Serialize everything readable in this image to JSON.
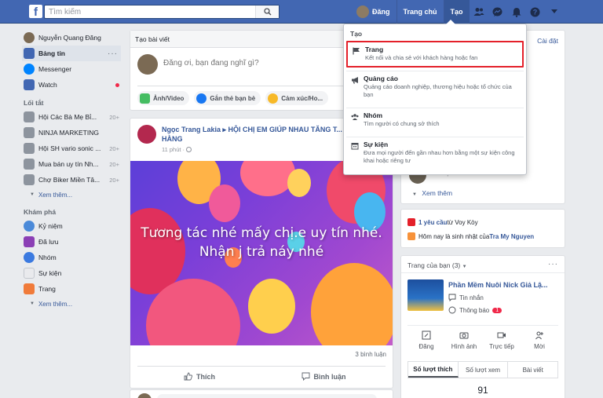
{
  "topbar": {
    "search_placeholder": "Tìm kiếm",
    "user_name": "Đăng",
    "home": "Trang chủ",
    "create": "Tạo"
  },
  "leftnav": {
    "profile_name": "Nguyễn Quang Đăng",
    "items": [
      {
        "label": "Bảng tin"
      },
      {
        "label": "Messenger"
      },
      {
        "label": "Watch"
      }
    ],
    "shortcuts_title": "Lối tắt",
    "shortcuts": [
      {
        "label": "Hội Các Bà Mẹ Bỉ...",
        "count": "20+"
      },
      {
        "label": "NINJA MARKETING",
        "count": ""
      },
      {
        "label": "Hội SH vario sonic ...",
        "count": "20+"
      },
      {
        "label": "Mua bán uy tín Nh...",
        "count": "20+"
      },
      {
        "label": "Chợ Biker Miền Tâ...",
        "count": "20+"
      }
    ],
    "see_more": "Xem thêm...",
    "explore_title": "Khám phá",
    "explore": [
      {
        "label": "Kỷ niệm"
      },
      {
        "label": "Đã lưu"
      },
      {
        "label": "Nhóm"
      },
      {
        "label": "Sự kiện"
      },
      {
        "label": "Trang"
      }
    ],
    "see_more_2": "Xem thêm..."
  },
  "create_post": {
    "title": "Tạo bài viết",
    "placeholder": "Đăng ơi, bạn đang nghĩ gì?",
    "actions": [
      "Ảnh/Video",
      "Gắn thẻ bạn bè",
      "Cảm xúc/Ho..."
    ]
  },
  "post": {
    "author": "Ngọc Trang Lakia ▸ HỘI CHỊ EM GIÚP NHAU TĂNG T... TÁC BÁN HÀNG",
    "time": "11 phút · ",
    "image_text": "Tương tác nhé mấy chị.e uy tín nhé. Nhận j trả náy nhé",
    "comments": "3 bình luận",
    "like": "Thích",
    "comment": "Bình luận"
  },
  "right": {
    "settings": "Cài đặt",
    "ghost_time": "37 phút trước",
    "see_more": "Xem thêm",
    "friend_request_count": "1 yêu cầu",
    "friend_request_from": " từ Voy Kòy",
    "birthday_prefix": "Hôm nay là sinh nhật của ",
    "birthday_name": "Tra My Nguyen",
    "your_pages_title": "Trang của bạn (3)",
    "page_name": "Phần Mềm Nuôi Nick Giả Lậ...",
    "page_messages": "Tin nhắn",
    "page_notifications": "Thông báo",
    "page_notification_count": "1",
    "page_actions": [
      "Đăng",
      "Hình ảnh",
      "Trực tiếp",
      "Mời"
    ],
    "stats_tabs": [
      "Số lượt thích",
      "Số lượt xem",
      "Bài viết"
    ],
    "likes_count": "91"
  },
  "dropdown": {
    "title": "Tạo",
    "items": [
      {
        "title": "Trang",
        "desc": "Kết nối và chia sẻ với khách hàng hoặc fan"
      },
      {
        "title": "Quảng cáo",
        "desc": "Quảng cáo doanh nghiệp, thương hiệu hoặc tổ chức của bạn"
      },
      {
        "title": "Nhóm",
        "desc": "Tìm người có chung sở thích"
      },
      {
        "title": "Sự kiện",
        "desc": "Đưa mọi người đến gần nhau hơn bằng một sự kiện công khai hoặc riêng tư"
      }
    ]
  },
  "colors": {
    "brand": "#4267b2",
    "highlight_border": "#e4202a",
    "link": "#365899"
  }
}
